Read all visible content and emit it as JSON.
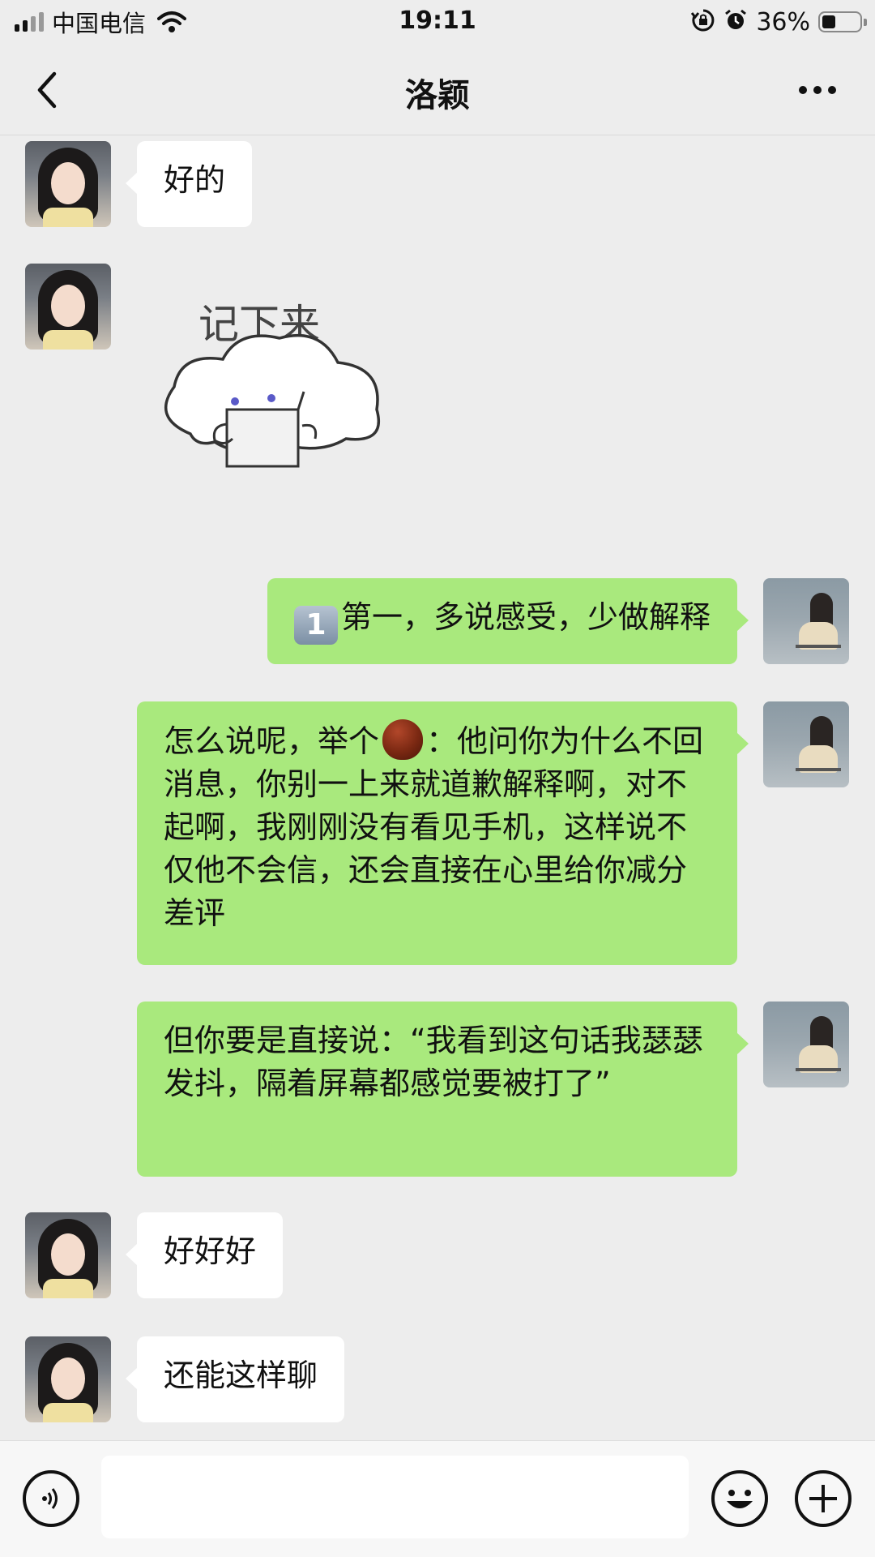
{
  "status_bar": {
    "carrier": "中国电信",
    "time": "19:11",
    "battery_percent": "36%",
    "battery_level": 0.36,
    "icons": [
      "signal-icon",
      "wifi-icon",
      "rotation-lock-icon",
      "alarm-icon",
      "battery-icon"
    ]
  },
  "nav": {
    "title": "洛颖",
    "back_icon": "chevron-left-icon",
    "more_icon": "more-dots-icon"
  },
  "messages": [
    {
      "side": "left",
      "type": "text",
      "text": "好的"
    },
    {
      "side": "left",
      "type": "sticker",
      "caption": "记下来"
    },
    {
      "side": "right",
      "type": "text",
      "emoji": "keycap-1",
      "text": "第一，多说感受，少做解释"
    },
    {
      "side": "right",
      "type": "text",
      "text_before": "怎么说呢，举个",
      "emoji": "chestnut",
      "text_after": "：他问你为什么不回消息，你别一上来就道歉解释啊，对不起啊，我刚刚没有看见手机，这样说不仅他不会信，还会直接在心里给你减分差评"
    },
    {
      "side": "right",
      "type": "text",
      "text": "但你要是直接说：“我看到这句话我瑟瑟发抖，隔着屏幕都感觉要被打了”"
    },
    {
      "side": "left",
      "type": "text",
      "text": "好好好"
    },
    {
      "side": "left",
      "type": "text",
      "text": "还能这样聊"
    }
  ],
  "keycap_label": "1",
  "input_bar": {
    "value": "",
    "icons": [
      "voice-icon",
      "emoji-icon",
      "plus-icon"
    ]
  }
}
